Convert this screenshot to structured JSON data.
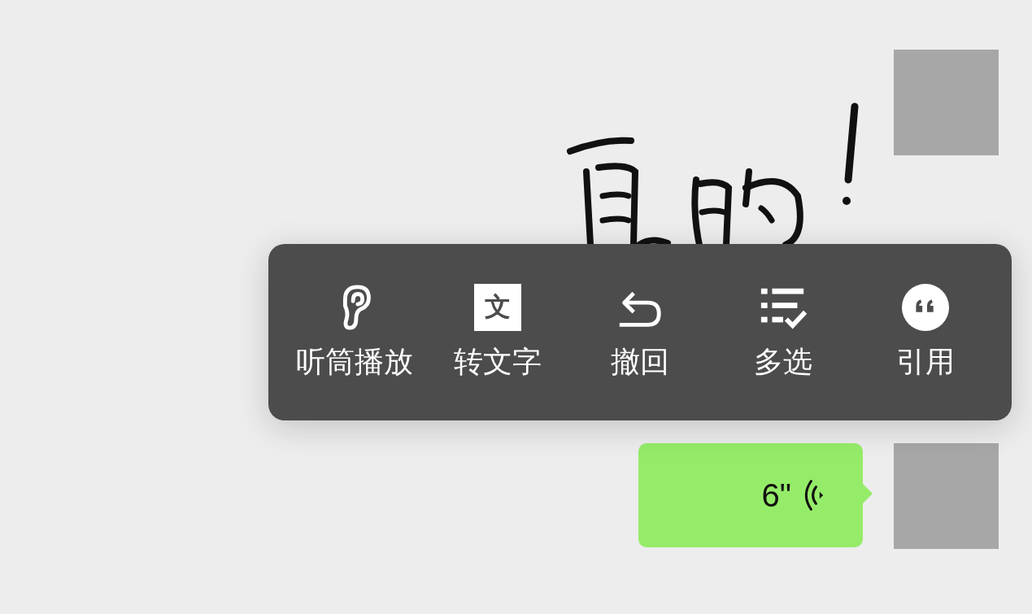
{
  "messages": [
    {
      "kind": "picture"
    },
    {
      "kind": "voice",
      "duration": "6\""
    }
  ],
  "context_menu": {
    "items": [
      {
        "kind": "ear",
        "label": "听筒播放"
      },
      {
        "kind": "translate",
        "glyph": "文",
        "label": "转文字"
      },
      {
        "kind": "undo",
        "label": "撤回"
      },
      {
        "kind": "multiselect",
        "label": "多选"
      },
      {
        "kind": "quote",
        "label": "引用"
      }
    ]
  }
}
